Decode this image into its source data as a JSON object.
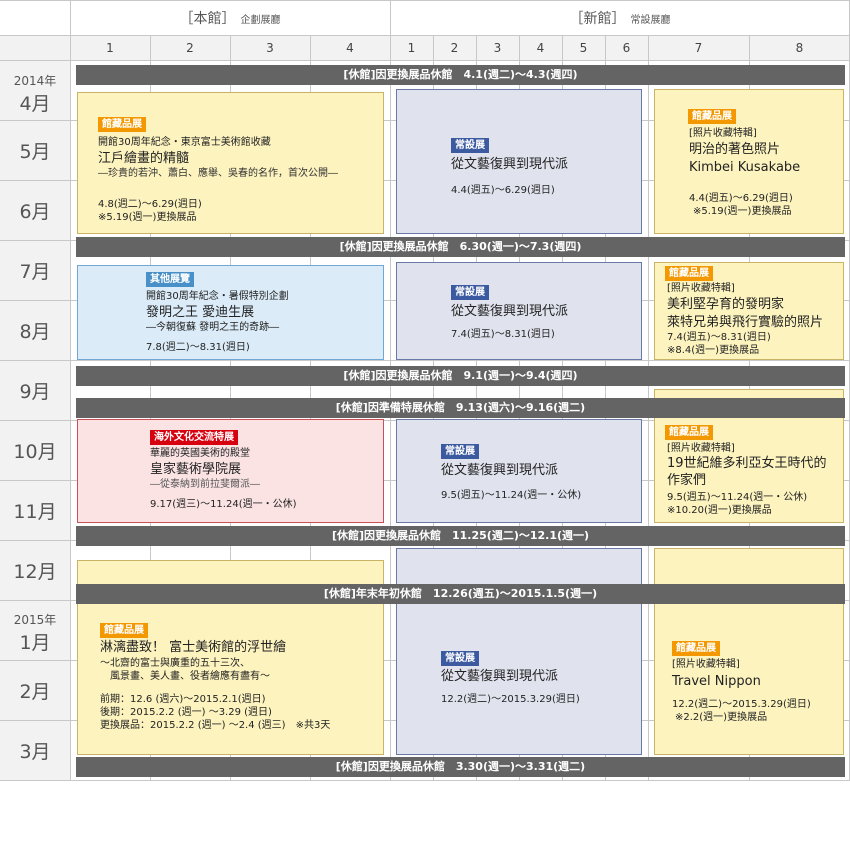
{
  "header": {
    "main_hall": "［本館］",
    "main_hall_sub": "企劃展廳",
    "new_hall": "［新館］",
    "new_hall_sub": "常設展廳"
  },
  "columns": [
    "1",
    "2",
    "3",
    "4",
    "1",
    "2",
    "3",
    "4",
    "5",
    "6",
    "7",
    "8"
  ],
  "months": [
    {
      "year": "2014年",
      "month": "4月"
    },
    {
      "month": "5月"
    },
    {
      "month": "6月"
    },
    {
      "month": "7月"
    },
    {
      "month": "8月"
    },
    {
      "month": "9月"
    },
    {
      "month": "10月"
    },
    {
      "month": "11月"
    },
    {
      "month": "12月"
    },
    {
      "year": "2015年",
      "month": "1月"
    },
    {
      "month": "2月"
    },
    {
      "month": "3月"
    }
  ],
  "closures": [
    "[休館]因更換展品休館　4.1(週二)～4.3(週四)",
    "[休館]因更換展品休館　6.30(週一)～7.3(週四)",
    "[休館]因更換展品休館　9.1(週一)～9.4(週四)",
    "[休館]因準備特展休館　9.13(週六)～9.16(週二)",
    "[休館]因更換展品休館　11.25(週二)～12.1(週一)",
    "[休館]年末年初休館　12.26(週五)～2015.1.5(週一)",
    "[休館]因更換展品休館　3.30(週一)～3.31(週二)"
  ],
  "main_hall": {
    "ex1": {
      "tag": "館藏品展",
      "line1": "開館30周年紀念・東京富士美術館收藏",
      "title": "江戶繪畫的精髓",
      "sub": "―珍貴的若沖、蕭白、應舉、吳春的名作，首次公開―",
      "date": "4.8(週二)～6.29(週日)",
      "note": "※5.19(週一)更換展品"
    },
    "ex2": {
      "tag": "其他展覽",
      "line1": "開館30周年紀念・暑假特別企劃",
      "title": "發明之王 愛迪生展",
      "sub": "―今朝復蘇 發明之王的奇跡―",
      "date": "7.8(週二)～8.31(週日)"
    },
    "ex3": {
      "tag": "海外文化交流特展",
      "line1": "華麗的英國美術的殿堂",
      "title": "皇家藝術學院展",
      "sub": "―從泰納到前拉斐爾派―",
      "date": "9.17(週三)～11.24(週一・公休)"
    },
    "ex4": {
      "tag": "館藏品展",
      "title": "淋漓盡致！ 富士美術館的浮世繪",
      "sub1": "～北齋的富士與廣重的五十三次、",
      "sub2": "風景畫、美人畫、役者繪應有盡有～",
      "d1": "前期：12.6 (週六)～2015.2.1(週日)",
      "d2": "後期：2015.2.2 (週一) ～3.29 (週日)",
      "d3": "更換展品：2015.2.2 (週一) ～2.4 (週三)　※共3天"
    }
  },
  "new_hall": {
    "p1": {
      "tag": "常設展",
      "title": "從文藝復興到現代派",
      "date": "4.4(週五)～6.29(週日)"
    },
    "p2": {
      "tag": "常設展",
      "title": "從文藝復興到現代派",
      "date": "7.4(週五)～8.31(週日)"
    },
    "p3": {
      "tag": "常設展",
      "title": "從文藝復興到現代派",
      "date": "9.5(週五)～11.24(週一・公休)"
    },
    "p4": {
      "tag": "常設展",
      "title": "從文藝復興到現代派",
      "date": "12.2(週二)～2015.3.29(週日)"
    },
    "photo1": {
      "tag": "館藏品展",
      "kind": "[照片收藏特輯]",
      "title1": "明治的著色照片",
      "title2": "Kimbei Kusakabe",
      "date": "4.4(週五)～6.29(週日)",
      "note": "※5.19(週一)更換展品"
    },
    "photo2": {
      "tag": "館藏品展",
      "kind": "[照片收藏特輯]",
      "title1": "美利堅孕育的發明家",
      "title2": "萊特兄弟與飛行實驗的照片",
      "date": "7.4(週五)～8.31(週日)",
      "note": "※8.4(週一)更換展品"
    },
    "photo3": {
      "tag": "館藏品展",
      "kind": "[照片收藏特輯]",
      "title1": "19世紀維多利亞女王時代的",
      "title2": "作家們",
      "date": "9.5(週五)～11.24(週一・公休)",
      "note": "※10.20(週一)更換展品"
    },
    "photo4": {
      "tag": "館藏品展",
      "kind": "[照片收藏特輯]",
      "title1": "Travel Nippon",
      "date": "12.2(週二)～2015.3.29(週日)",
      "note": "※2.2(週一)更換展品"
    }
  },
  "colors": {
    "closed": "#646464",
    "yellow": "#fcf3bf",
    "blue": "#e0e3ee",
    "lightblue": "#dbecf8",
    "red": "#fbe3e3",
    "orange_tag": "#f39800"
  }
}
